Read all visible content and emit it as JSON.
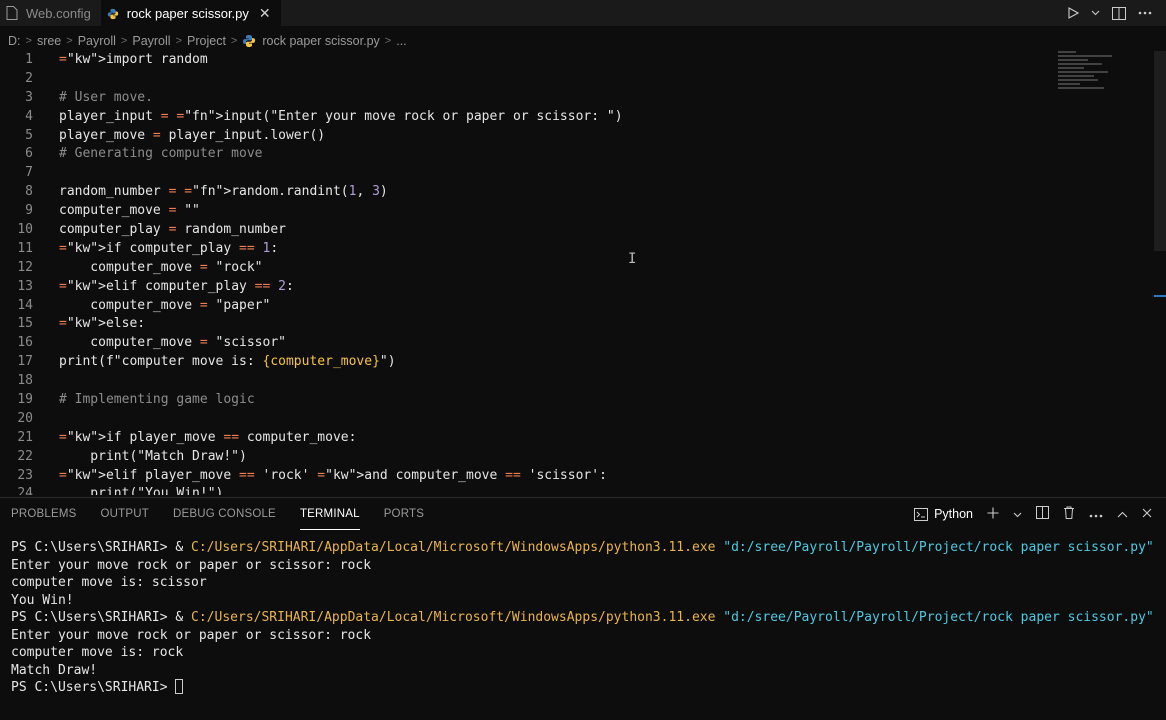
{
  "tabs": [
    {
      "label": "Web.config",
      "icon": "file-icon",
      "active": false
    },
    {
      "label": "rock paper scissor.py",
      "icon": "python-icon",
      "active": true
    }
  ],
  "tab_close_glyph": "✕",
  "breadcrumb": [
    "D:",
    "sree",
    "Payroll",
    "Payroll",
    "Project",
    "rock paper scissor.py",
    "..."
  ],
  "editor": {
    "line_numbers": [
      "1",
      "2",
      "3",
      "4",
      "5",
      "6",
      "7",
      "8",
      "9",
      "10",
      "11",
      "12",
      "13",
      "14",
      "15",
      "16",
      "17",
      "18",
      "19",
      "20",
      "21",
      "22",
      "23",
      "24"
    ],
    "lines": [
      "import random",
      "",
      "# User move.",
      "player_input = input(\"Enter your move rock or paper or scissor: \")",
      "player_move = player_input.lower()",
      "# Generating computer move",
      "",
      "random_number = random.randint(1, 3)",
      "computer_move = \"\"",
      "computer_play = random_number",
      "if computer_play == 1:",
      "    computer_move = \"rock\"",
      "elif computer_play == 2:",
      "    computer_move = \"paper\"",
      "else:",
      "    computer_move = \"scissor\"",
      "print(f\"computer move is: {computer_move}\")",
      "",
      "# Implementing game logic",
      "",
      "if player_move == computer_move:",
      "    print(\"Match Draw!\")",
      "elif player_move == 'rock' and computer_move == 'scissor':",
      "    print(\"You Win!\")"
    ]
  },
  "panel": {
    "tabs": [
      "PROBLEMS",
      "OUTPUT",
      "DEBUG CONSOLE",
      "TERMINAL",
      "PORTS"
    ],
    "active_tab": "TERMINAL",
    "shell_label": "Python"
  },
  "terminal": {
    "prompt": "PS C:\\Users\\SRIHARI> ",
    "run_cmd_prefix": "& ",
    "exe_path": "C:/Users/SRIHARI/AppData/Local/Microsoft/WindowsApps/python3.11.exe",
    "script_arg": "\"d:/sree/Payroll/Payroll/Project/rock paper scissor.py\"",
    "input_prompt": "Enter your move rock or paper or scissor: rock",
    "run1_computer": "computer move is: scissor",
    "run1_result": "You Win!",
    "run2_computer": "computer move is: rock",
    "run2_result": "Match Draw!"
  },
  "colors": {
    "keyword": "#f58b63",
    "number": "#b19cd9",
    "comment": "#8c8c8c",
    "terminal_path": "#e9b44c",
    "terminal_string": "#4ec9e0",
    "accent": "#2f78c4"
  }
}
